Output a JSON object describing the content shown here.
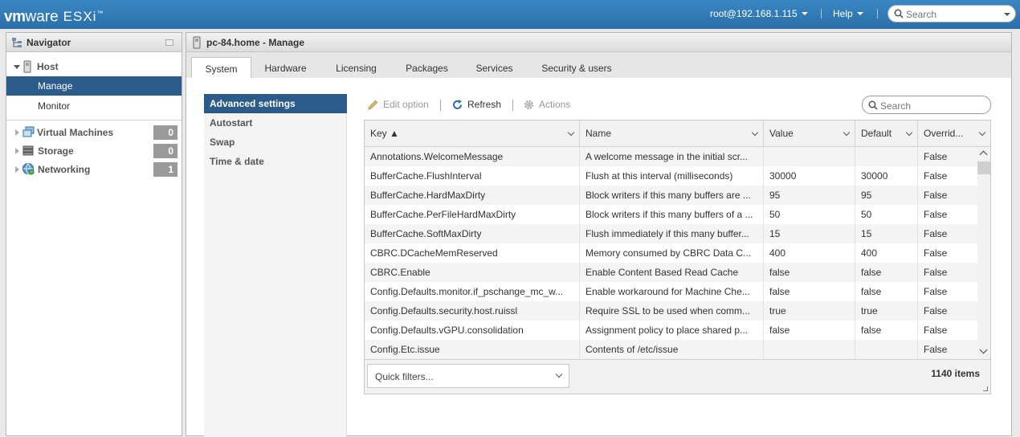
{
  "app": {
    "brand_vm": "vm",
    "brand_ware": "ware",
    "product": "ESXi",
    "trademark": "™"
  },
  "topbar": {
    "user_menu": "root@192.168.1.115",
    "help_menu": "Help",
    "search_placeholder": "Search"
  },
  "navigator": {
    "title": "Navigator",
    "host_label": "Host",
    "host_children": [
      {
        "label": "Manage",
        "selected": true
      },
      {
        "label": "Monitor",
        "selected": false
      }
    ],
    "items": [
      {
        "label": "Virtual Machines",
        "count": "0",
        "icon": "vm-icon"
      },
      {
        "label": "Storage",
        "count": "0",
        "icon": "storage-icon"
      },
      {
        "label": "Networking",
        "count": "1",
        "icon": "network-icon"
      }
    ]
  },
  "main": {
    "title": "pc-84.home - Manage",
    "tabs": [
      "System",
      "Hardware",
      "Licensing",
      "Packages",
      "Services",
      "Security & users"
    ],
    "active_tab": "System"
  },
  "subnav": {
    "items": [
      "Advanced settings",
      "Autostart",
      "Swap",
      "Time & date"
    ],
    "selected": "Advanced settings"
  },
  "toolbar": {
    "edit_option": "Edit option",
    "refresh": "Refresh",
    "actions": "Actions",
    "search_placeholder": "Search"
  },
  "grid": {
    "columns": [
      "Key ▲",
      "Name",
      "Value",
      "Default",
      "Overrid..."
    ],
    "rows": [
      [
        "Annotations.WelcomeMessage",
        "A welcome message in the initial scr...",
        "",
        "",
        "False"
      ],
      [
        "BufferCache.FlushInterval",
        "Flush at this interval (milliseconds)",
        "30000",
        "30000",
        "False"
      ],
      [
        "BufferCache.HardMaxDirty",
        "Block writers if this many buffers are ...",
        "95",
        "95",
        "False"
      ],
      [
        "BufferCache.PerFileHardMaxDirty",
        "Block writers if this many buffers of a ...",
        "50",
        "50",
        "False"
      ],
      [
        "BufferCache.SoftMaxDirty",
        "Flush immediately if this many buffer...",
        "15",
        "15",
        "False"
      ],
      [
        "CBRC.DCacheMemReserved",
        "Memory consumed by CBRC Data C...",
        "400",
        "400",
        "False"
      ],
      [
        "CBRC.Enable",
        "Enable Content Based Read Cache",
        "false",
        "false",
        "False"
      ],
      [
        "Config.Defaults.monitor.if_pschange_mc_w...",
        "Enable workaround for Machine Che...",
        "false",
        "false",
        "False"
      ],
      [
        "Config.Defaults.security.host.ruissl",
        "Require SSL to be used when comm...",
        "true",
        "true",
        "False"
      ],
      [
        "Config.Defaults.vGPU.consolidation",
        "Assignment policy to place shared p...",
        "false",
        "false",
        "False"
      ],
      [
        "Config.Etc.issue",
        "Contents of /etc/issue",
        "",
        "",
        "False"
      ]
    ],
    "quick_filters": "Quick filters...",
    "item_count": "1140 items"
  },
  "colors": {
    "topbar": "#2f78b4",
    "selection": "#2b5b8b",
    "count_badge": "#9a9a9a"
  }
}
